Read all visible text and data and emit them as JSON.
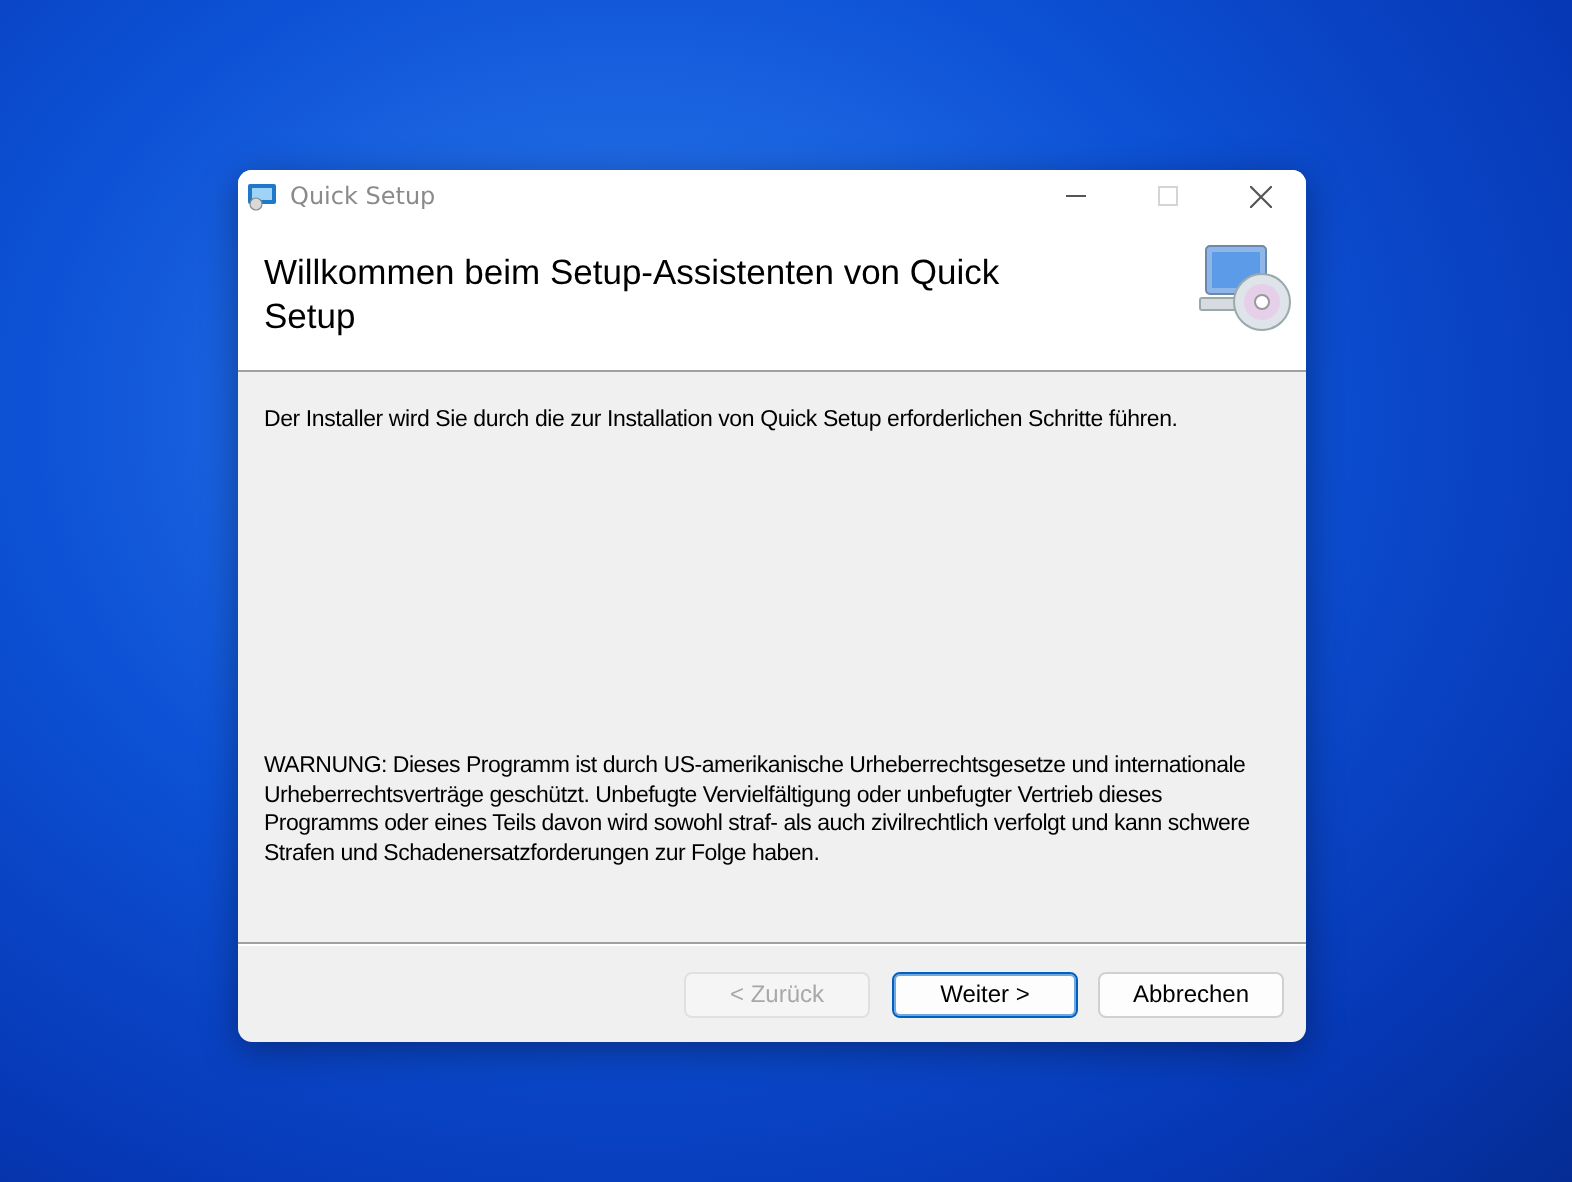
{
  "window": {
    "title": "Quick Setup",
    "controls": [
      {
        "kind": "minimize",
        "disabled": false
      },
      {
        "kind": "maximize",
        "disabled": true
      },
      {
        "kind": "close",
        "disabled": false
      }
    ]
  },
  "header": {
    "title": "Willkommen beim Setup-Assistenten von Quick Setup"
  },
  "intro": "Der Installer wird Sie durch die zur Installation von Quick Setup erforderlichen Schritte führen.",
  "warning": "WARNUNG: Dieses Programm ist durch US-amerikanische Urheberrechtsgesetze und internationale Urheberrechtsverträge geschützt. Unbefugte Vervielfältigung oder unbefugter Vertrieb dieses Programms oder eines Teils davon wird sowohl straf- als auch zivilrechtlich verfolgt und kann schwere Strafen und Schadenersatzforderungen zur Folge haben.",
  "buttons": [
    {
      "label": "< Zurück",
      "disabled": true,
      "default": false
    },
    {
      "label": "Weiter >",
      "disabled": false,
      "default": true
    },
    {
      "label": "Abbrechen",
      "disabled": false,
      "default": false
    }
  ]
}
